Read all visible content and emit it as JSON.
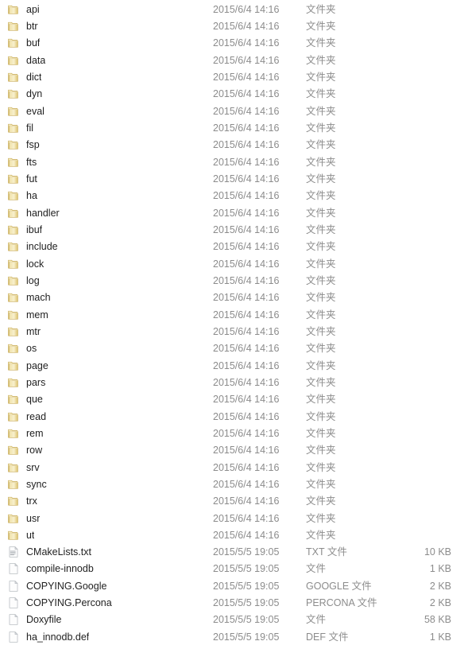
{
  "window": {
    "view_mode": "details-list",
    "background_color": "#ffffff",
    "name_text_color": "#1f1f1f",
    "meta_text_color": "#8c8c8c",
    "folder_icon_color": "#e8d48a",
    "file_icon_color": "#f2f2f2"
  },
  "columns": {
    "name": "",
    "date_modified": "",
    "type": "",
    "size": ""
  },
  "labels": {
    "folder_type": "文件夹",
    "file_type_plain": "文件",
    "folder_icon": "folder-icon",
    "file_icon": "file-icon",
    "text_file_icon": "text-file-icon"
  },
  "rows": [
    {
      "name": "api",
      "date": "2015/6/4 14:16",
      "type": "文件夹",
      "size": "",
      "icon": "folder"
    },
    {
      "name": "btr",
      "date": "2015/6/4 14:16",
      "type": "文件夹",
      "size": "",
      "icon": "folder"
    },
    {
      "name": "buf",
      "date": "2015/6/4 14:16",
      "type": "文件夹",
      "size": "",
      "icon": "folder"
    },
    {
      "name": "data",
      "date": "2015/6/4 14:16",
      "type": "文件夹",
      "size": "",
      "icon": "folder"
    },
    {
      "name": "dict",
      "date": "2015/6/4 14:16",
      "type": "文件夹",
      "size": "",
      "icon": "folder"
    },
    {
      "name": "dyn",
      "date": "2015/6/4 14:16",
      "type": "文件夹",
      "size": "",
      "icon": "folder"
    },
    {
      "name": "eval",
      "date": "2015/6/4 14:16",
      "type": "文件夹",
      "size": "",
      "icon": "folder"
    },
    {
      "name": "fil",
      "date": "2015/6/4 14:16",
      "type": "文件夹",
      "size": "",
      "icon": "folder"
    },
    {
      "name": "fsp",
      "date": "2015/6/4 14:16",
      "type": "文件夹",
      "size": "",
      "icon": "folder"
    },
    {
      "name": "fts",
      "date": "2015/6/4 14:16",
      "type": "文件夹",
      "size": "",
      "icon": "folder"
    },
    {
      "name": "fut",
      "date": "2015/6/4 14:16",
      "type": "文件夹",
      "size": "",
      "icon": "folder"
    },
    {
      "name": "ha",
      "date": "2015/6/4 14:16",
      "type": "文件夹",
      "size": "",
      "icon": "folder"
    },
    {
      "name": "handler",
      "date": "2015/6/4 14:16",
      "type": "文件夹",
      "size": "",
      "icon": "folder"
    },
    {
      "name": "ibuf",
      "date": "2015/6/4 14:16",
      "type": "文件夹",
      "size": "",
      "icon": "folder"
    },
    {
      "name": "include",
      "date": "2015/6/4 14:16",
      "type": "文件夹",
      "size": "",
      "icon": "folder"
    },
    {
      "name": "lock",
      "date": "2015/6/4 14:16",
      "type": "文件夹",
      "size": "",
      "icon": "folder"
    },
    {
      "name": "log",
      "date": "2015/6/4 14:16",
      "type": "文件夹",
      "size": "",
      "icon": "folder"
    },
    {
      "name": "mach",
      "date": "2015/6/4 14:16",
      "type": "文件夹",
      "size": "",
      "icon": "folder"
    },
    {
      "name": "mem",
      "date": "2015/6/4 14:16",
      "type": "文件夹",
      "size": "",
      "icon": "folder"
    },
    {
      "name": "mtr",
      "date": "2015/6/4 14:16",
      "type": "文件夹",
      "size": "",
      "icon": "folder"
    },
    {
      "name": "os",
      "date": "2015/6/4 14:16",
      "type": "文件夹",
      "size": "",
      "icon": "folder"
    },
    {
      "name": "page",
      "date": "2015/6/4 14:16",
      "type": "文件夹",
      "size": "",
      "icon": "folder"
    },
    {
      "name": "pars",
      "date": "2015/6/4 14:16",
      "type": "文件夹",
      "size": "",
      "icon": "folder"
    },
    {
      "name": "que",
      "date": "2015/6/4 14:16",
      "type": "文件夹",
      "size": "",
      "icon": "folder"
    },
    {
      "name": "read",
      "date": "2015/6/4 14:16",
      "type": "文件夹",
      "size": "",
      "icon": "folder"
    },
    {
      "name": "rem",
      "date": "2015/6/4 14:16",
      "type": "文件夹",
      "size": "",
      "icon": "folder"
    },
    {
      "name": "row",
      "date": "2015/6/4 14:16",
      "type": "文件夹",
      "size": "",
      "icon": "folder"
    },
    {
      "name": "srv",
      "date": "2015/6/4 14:16",
      "type": "文件夹",
      "size": "",
      "icon": "folder"
    },
    {
      "name": "sync",
      "date": "2015/6/4 14:16",
      "type": "文件夹",
      "size": "",
      "icon": "folder"
    },
    {
      "name": "trx",
      "date": "2015/6/4 14:16",
      "type": "文件夹",
      "size": "",
      "icon": "folder"
    },
    {
      "name": "usr",
      "date": "2015/6/4 14:16",
      "type": "文件夹",
      "size": "",
      "icon": "folder"
    },
    {
      "name": "ut",
      "date": "2015/6/4 14:16",
      "type": "文件夹",
      "size": "",
      "icon": "folder"
    },
    {
      "name": "CMakeLists.txt",
      "date": "2015/5/5 19:05",
      "type": "TXT 文件",
      "size": "10 KB",
      "icon": "text-file"
    },
    {
      "name": "compile-innodb",
      "date": "2015/5/5 19:05",
      "type": "文件",
      "size": "1 KB",
      "icon": "file"
    },
    {
      "name": "COPYING.Google",
      "date": "2015/5/5 19:05",
      "type": "GOOGLE 文件",
      "size": "2 KB",
      "icon": "file"
    },
    {
      "name": "COPYING.Percona",
      "date": "2015/5/5 19:05",
      "type": "PERCONA 文件",
      "size": "2 KB",
      "icon": "file"
    },
    {
      "name": "Doxyfile",
      "date": "2015/5/5 19:05",
      "type": "文件",
      "size": "58 KB",
      "icon": "file"
    },
    {
      "name": "ha_innodb.def",
      "date": "2015/5/5 19:05",
      "type": "DEF 文件",
      "size": "1 KB",
      "icon": "file"
    }
  ]
}
